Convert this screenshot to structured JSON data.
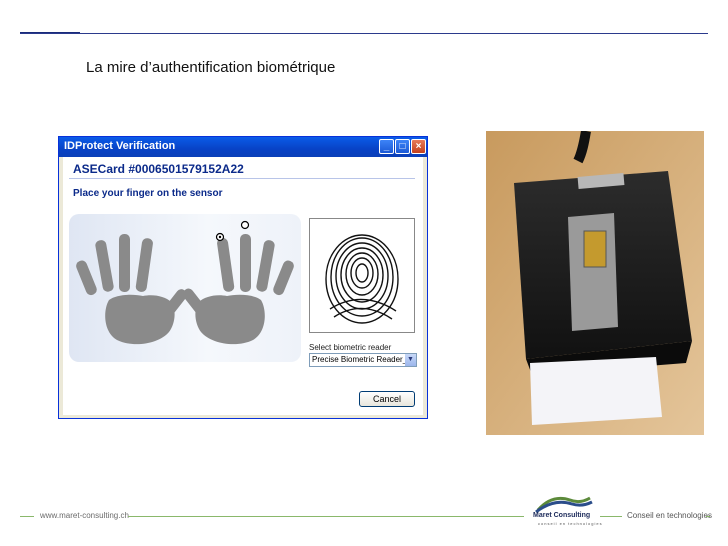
{
  "slide": {
    "title": "La mire d’authentification biométrique"
  },
  "dialog": {
    "window_title": "IDProtect Verification",
    "card_id": "ASECard #0006501579152A22",
    "instruction": "Place your finger on the sensor",
    "reader_label": "Select biometric reader",
    "reader_selected": "Precise Biometric Reader_0",
    "cancel_label": "Cancel",
    "window_buttons": {
      "minimize": "_",
      "maximize": "□",
      "close": "×"
    }
  },
  "footer": {
    "url": "www.maret-consulting.ch",
    "company": "Maret Consulting",
    "company_tagline": "conseil en technologies",
    "right_text": "Conseil en technologies"
  },
  "colors": {
    "title_bar": "#0842c6",
    "dialog_text": "#0b2a8a",
    "hand": "#8a8a8a",
    "footer_line": "#8ab86b"
  },
  "icons": {
    "hands": "hand-silhouette-icon",
    "fingerprint": "fingerprint-icon",
    "reader_photo": "fingerprint-reader-photo"
  }
}
